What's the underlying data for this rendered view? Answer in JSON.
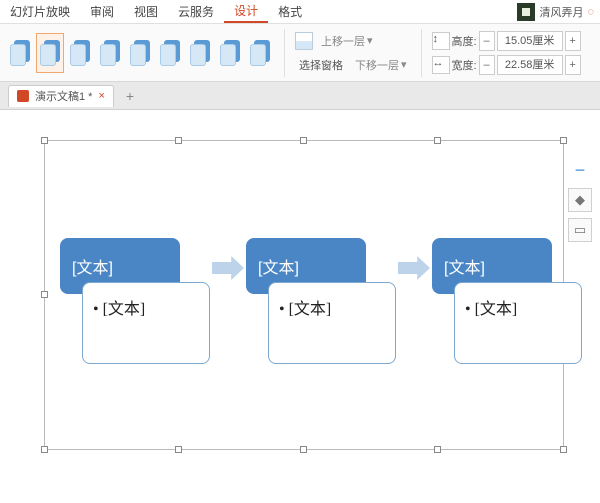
{
  "tabs": {
    "slideshow": "幻灯片放映",
    "review": "审阅",
    "view": "视图",
    "cloud": "云服务",
    "design": "设计",
    "format": "格式"
  },
  "user": {
    "name": "清风弄月"
  },
  "ribbon": {
    "selectPane": "选择窗格",
    "moveUp": "上移一层",
    "moveDown": "下移一层",
    "height": "高度:",
    "width": "宽度:",
    "heightVal": "15.05厘米",
    "widthVal": "22.58厘米",
    "minus": "–",
    "plus": "+"
  },
  "doc": {
    "name": "演示文稿1 *",
    "close": "×",
    "add": "+"
  },
  "smart": {
    "topText": "[文本]",
    "bullet": "• [文本]"
  }
}
